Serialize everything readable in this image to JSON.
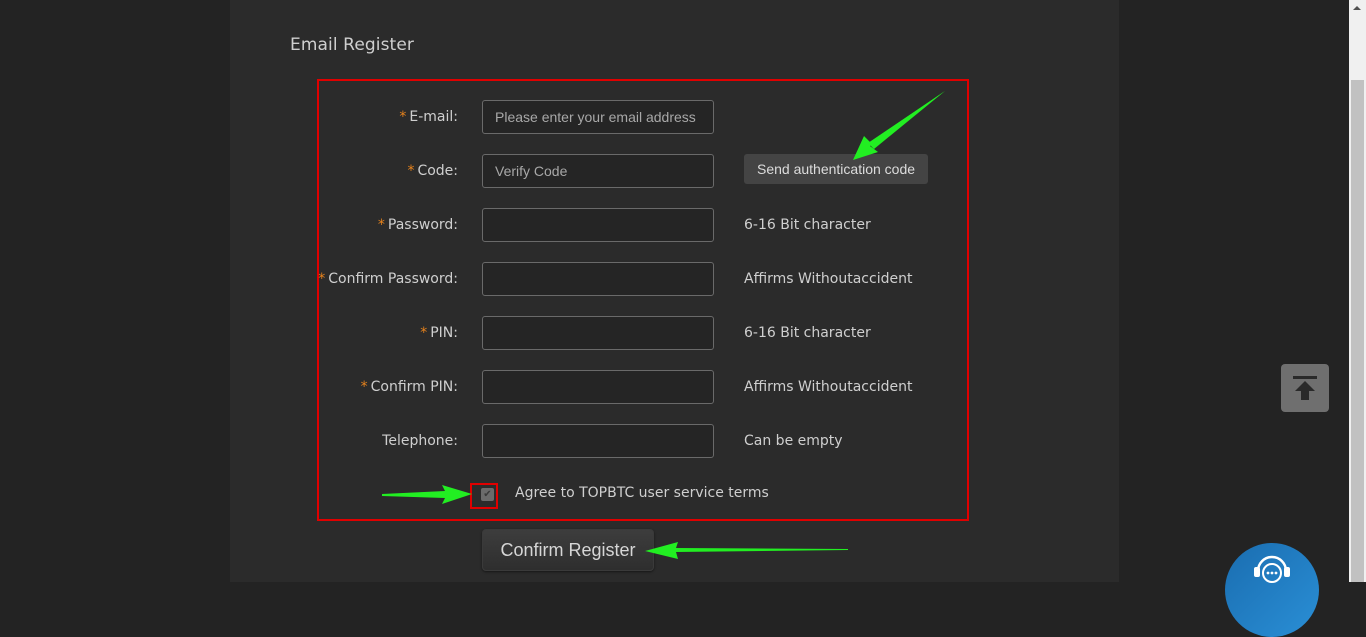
{
  "page": {
    "title": "Email Register"
  },
  "form": {
    "fields": [
      {
        "label": "E-mail:",
        "required": true,
        "placeholder": "Please enter your email address",
        "value": "",
        "hint": ""
      },
      {
        "label": "Code:",
        "required": true,
        "placeholder": "Verify Code",
        "value": "",
        "hint": ""
      },
      {
        "label": "Password:",
        "required": true,
        "placeholder": "",
        "value": "",
        "hint": "6-16 Bit character"
      },
      {
        "label": "Confirm Password:",
        "required": true,
        "placeholder": "",
        "value": "",
        "hint": "Affirms Withoutaccident"
      },
      {
        "label": "PIN:",
        "required": true,
        "placeholder": "",
        "value": "",
        "hint": "6-16 Bit character"
      },
      {
        "label": "Confirm PIN:",
        "required": true,
        "placeholder": "",
        "value": "",
        "hint": "Affirms Withoutaccident"
      },
      {
        "label": "Telephone:",
        "required": false,
        "placeholder": "",
        "value": "",
        "hint": "Can be empty"
      }
    ],
    "required_marker": "*",
    "send_code_label": "Send authentication code",
    "agree_label": "Agree to TOPBTC user service terms",
    "agree_checked": true,
    "confirm_label": "Confirm Register"
  },
  "annotations": {
    "highlight_color": "#e00000",
    "arrow_color": "#22ee22"
  },
  "floating": {
    "to_top_icon": "arrow-up-to-top-icon",
    "chat_icon": "customer-service-headset-icon"
  },
  "colors": {
    "background": "#232323",
    "panel": "#2b2b2b",
    "required_star": "#e8831c",
    "text": "#cfcfcf",
    "chat_button": "#1f7dc4"
  }
}
